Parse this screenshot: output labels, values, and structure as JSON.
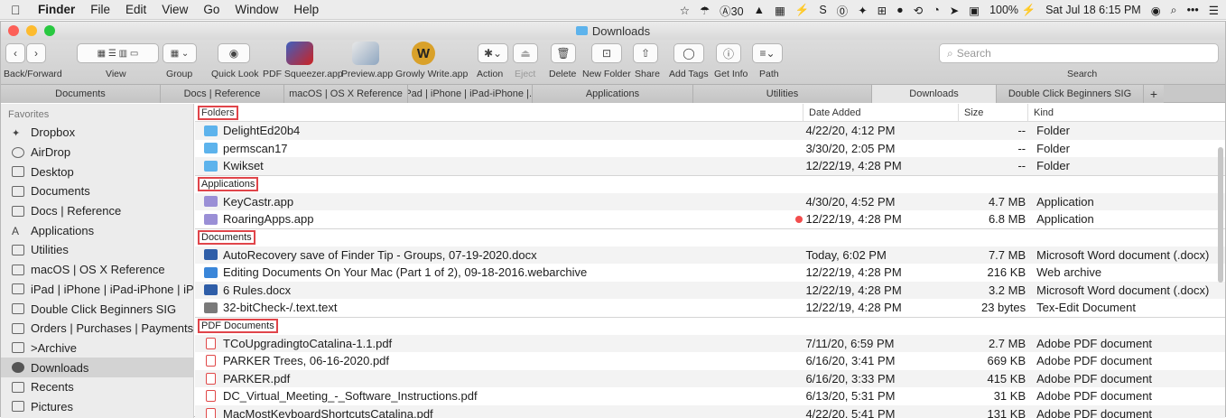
{
  "menubar": {
    "app": "Finder",
    "items": [
      "File",
      "Edit",
      "View",
      "Go",
      "Window",
      "Help"
    ],
    "status": [
      "☆",
      "☂",
      "Ⓐ30",
      "▲",
      "▦",
      "⚡",
      "S",
      "⓪",
      "✦",
      "⊞",
      "●",
      "⟲",
      "◔",
      "➤",
      "▣",
      "100% ⚡",
      "Sat Jul 18  6:15 PM",
      "◉",
      "⌕",
      "•••",
      "☰"
    ]
  },
  "window": {
    "title": "Downloads"
  },
  "toolbar": {
    "labels": [
      "Back/Forward",
      "View",
      "Group",
      "Quick Look",
      "PDF Squeezer.app",
      "Preview.app",
      "Growly Write.app",
      "Action",
      "Eject",
      "Delete",
      "New Folder",
      "Share",
      "Add Tags",
      "Get Info",
      "Path"
    ],
    "search_placeholder": "Search",
    "search_label": "Search"
  },
  "tabs": [
    {
      "label": "Documents"
    },
    {
      "label": "Docs | Reference"
    },
    {
      "label": "macOS | OS X Reference"
    },
    {
      "label": "iPad | iPhone | iPad-iPhone |..."
    },
    {
      "label": "Applications"
    },
    {
      "label": "Utilities"
    },
    {
      "label": "Downloads",
      "active": true
    },
    {
      "label": "Double Click Beginners SIG"
    }
  ],
  "sidebar": {
    "heading": "Favorites",
    "items": [
      "Dropbox",
      "AirDrop",
      "Desktop",
      "Documents",
      "Docs | Reference",
      "Applications",
      "Utilities",
      "macOS | OS X Reference",
      "iPad | iPhone | iPad-iPhone | iPod",
      "Double Click Beginners SIG",
      "Orders | Purchases | Payments",
      ">Archive",
      "Downloads",
      "Recents",
      "Pictures"
    ],
    "selected": "Downloads"
  },
  "columns": {
    "name": "Folders",
    "date": "Date Added",
    "size": "Size",
    "kind": "Kind"
  },
  "groups": [
    {
      "title": "Folders",
      "rows": [
        {
          "name": "DelightEd20b4",
          "date": "4/22/20, 4:12 PM",
          "size": "--",
          "kind": "Folder",
          "icon": "folder-icon"
        },
        {
          "name": "permscan17",
          "date": "3/30/20, 2:05 PM",
          "size": "--",
          "kind": "Folder",
          "icon": "folder-icon"
        },
        {
          "name": "Kwikset",
          "date": "12/22/19, 4:28 PM",
          "size": "--",
          "kind": "Folder",
          "icon": "folder-icon"
        }
      ]
    },
    {
      "title": "Applications",
      "rows": [
        {
          "name": "KeyCastr.app",
          "date": "4/30/20, 4:52 PM",
          "size": "4.7 MB",
          "kind": "Application",
          "icon": "app-icon"
        },
        {
          "name": "RoaringApps.app",
          "date": "12/22/19, 4:28 PM",
          "size": "6.8 MB",
          "kind": "Application",
          "icon": "app-icon",
          "tag": "red"
        }
      ]
    },
    {
      "title": "Documents",
      "rows": [
        {
          "name": "AutoRecovery save of Finder Tip - Groups, 07-19-2020.docx",
          "date": "Today, 6:02 PM",
          "size": "7.7 MB",
          "kind": "Microsoft Word document (.docx)",
          "icon": "word-doc-icon"
        },
        {
          "name": "Editing Documents On Your Mac (Part 1 of 2), 09-18-2016.webarchive",
          "date": "12/22/19, 4:28 PM",
          "size": "216 KB",
          "kind": "Web archive",
          "icon": "webarchive-icon"
        },
        {
          "name": "6 Rules.docx",
          "date": "12/22/19, 4:28 PM",
          "size": "3.2 MB",
          "kind": "Microsoft Word document (.docx)",
          "icon": "word-doc-icon"
        },
        {
          "name": "32-bitCheck-/.text.text",
          "date": "12/22/19, 4:28 PM",
          "size": "23 bytes",
          "kind": "Tex-Edit Document",
          "icon": "text-doc-icon"
        }
      ]
    },
    {
      "title": "PDF Documents",
      "rows": [
        {
          "name": "TCoUpgradingtoCatalina-1.1.pdf",
          "date": "7/11/20, 6:59 PM",
          "size": "2.7 MB",
          "kind": "Adobe PDF document",
          "icon": "pdf-icon"
        },
        {
          "name": "PARKER Trees, 06-16-2020.pdf",
          "date": "6/16/20, 3:41 PM",
          "size": "669 KB",
          "kind": "Adobe PDF document",
          "icon": "pdf-icon"
        },
        {
          "name": "PARKER.pdf",
          "date": "6/16/20, 3:33 PM",
          "size": "415 KB",
          "kind": "Adobe PDF document",
          "icon": "pdf-icon"
        },
        {
          "name": "DC_Virtual_Meeting_-_Software_Instructions.pdf",
          "date": "6/13/20, 5:31 PM",
          "size": "31 KB",
          "kind": "Adobe PDF document",
          "icon": "pdf-icon"
        },
        {
          "name": "MacMostKeyboardShortcutsCatalina.pdf",
          "date": "4/22/20, 5:41 PM",
          "size": "131 KB",
          "kind": "Adobe PDF document",
          "icon": "pdf-icon"
        }
      ]
    }
  ],
  "colors": {
    "highlight": "#e0454a",
    "folder": "#5db3ec",
    "tag_red": "#f24d4d"
  }
}
